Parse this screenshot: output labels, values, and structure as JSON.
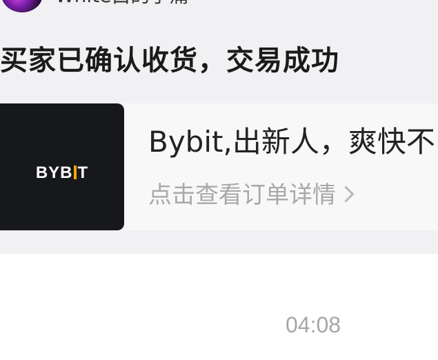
{
  "header": {
    "username": "White白的手痛"
  },
  "message": {
    "status_text": "买家已确认收货，交易成功",
    "order_card": {
      "brand_logo_text": "BYBIT",
      "product_title": "Bybit,出新人，爽快不",
      "detail_link": "点击查看订单详情"
    }
  },
  "timestamp": "04:08",
  "colors": {
    "background": "#f1f1f3",
    "card": "#f8f8f8",
    "thumbnail": "#17181c",
    "brand_accent": "#f7a600"
  }
}
